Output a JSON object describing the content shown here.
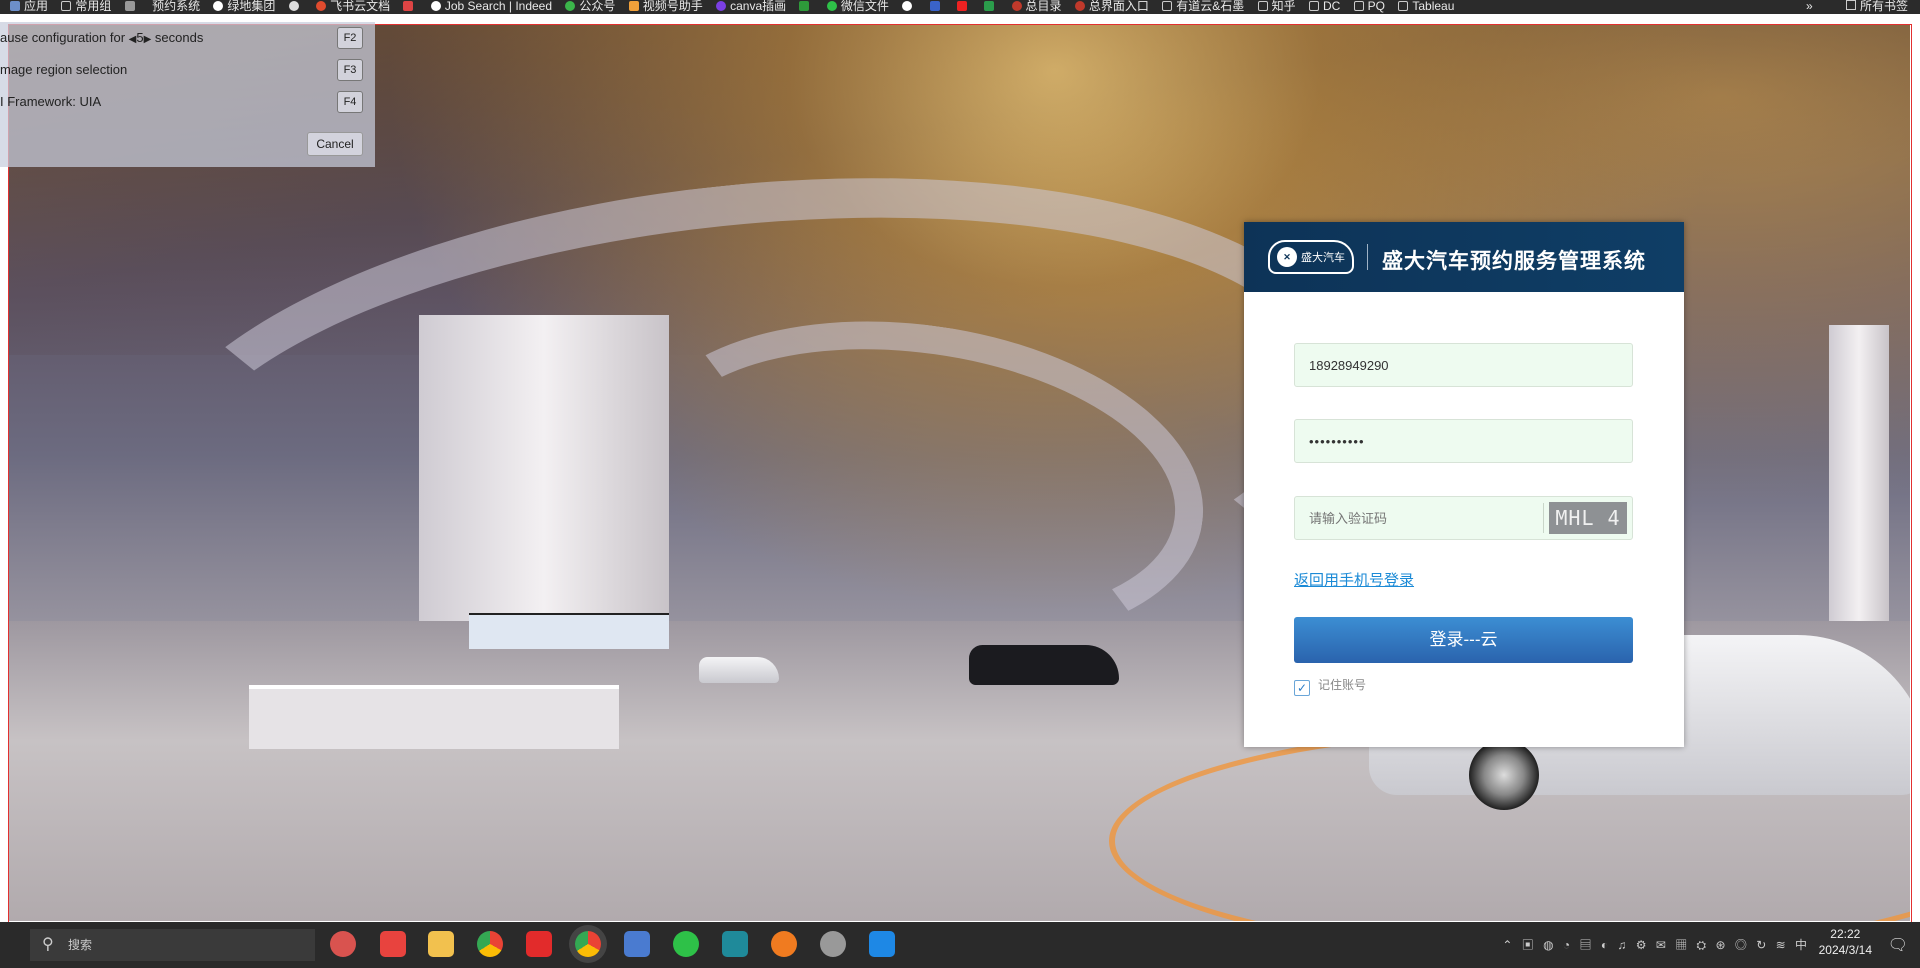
{
  "bookmarks": {
    "items": [
      {
        "label": "应用",
        "icon": "apps-grid-icon"
      },
      {
        "label": "常用组",
        "icon": "folder-icon"
      },
      {
        "label": "",
        "icon": "mail-icon"
      },
      {
        "label": "预约系统",
        "icon": "bookmark-icon"
      },
      {
        "label": "绿地集团",
        "icon": "bookmark-icon"
      },
      {
        "label": "",
        "icon": "openai-icon"
      },
      {
        "label": "飞书云文档",
        "icon": "feishu-icon"
      },
      {
        "label": "",
        "icon": "gmail-icon"
      },
      {
        "label": "Job Search | Indeed",
        "icon": "indeed-icon"
      },
      {
        "label": "公众号",
        "icon": "wechat-official-icon"
      },
      {
        "label": "视频号助手",
        "icon": "video-icon"
      },
      {
        "label": "canva插画",
        "icon": "canva-icon"
      },
      {
        "label": "",
        "icon": "green-app-icon"
      },
      {
        "label": "微信文件",
        "icon": "wechat-icon"
      },
      {
        "label": "",
        "icon": "google-icon"
      },
      {
        "label": "",
        "icon": "star-icon"
      },
      {
        "label": "",
        "icon": "youtube-icon"
      },
      {
        "label": "",
        "icon": "green-check-icon"
      },
      {
        "label": "总目录",
        "icon": "bookmark-icon"
      },
      {
        "label": "总界面入口",
        "icon": "bookmark-icon"
      },
      {
        "label": "有道云&石墨",
        "icon": "folder-icon"
      },
      {
        "label": "知乎",
        "icon": "folder-icon"
      },
      {
        "label": "DC",
        "icon": "folder-icon"
      },
      {
        "label": "PQ",
        "icon": "folder-icon"
      },
      {
        "label": "Tableau",
        "icon": "folder-icon"
      }
    ],
    "more": "»",
    "all_bookmarks": "所有书签"
  },
  "recorder": {
    "pause_label": "ause configuration for",
    "pause_value": "5",
    "pause_unit": "seconds",
    "pause_key": "F2",
    "image_label": "mage region selection",
    "image_key": "F3",
    "framework_label": "I Framework: UIA",
    "framework_key": "F4",
    "cancel": "Cancel"
  },
  "login": {
    "logo_text": "盛大汽车",
    "title": "盛大汽车预约服务管理系统",
    "username_value": "18928949290",
    "password_value": "••••••••••",
    "captcha_placeholder": "请输入验证码",
    "captcha_image_text": "MHL 4",
    "switch_link": "返回用手机号登录",
    "submit": "登录---云",
    "remember_label": "记住账号",
    "remember_checked": true
  },
  "taskbar": {
    "search_placeholder": "搜索",
    "clock_time": "22:22",
    "clock_date": "2024/3/14",
    "ime": "中"
  }
}
